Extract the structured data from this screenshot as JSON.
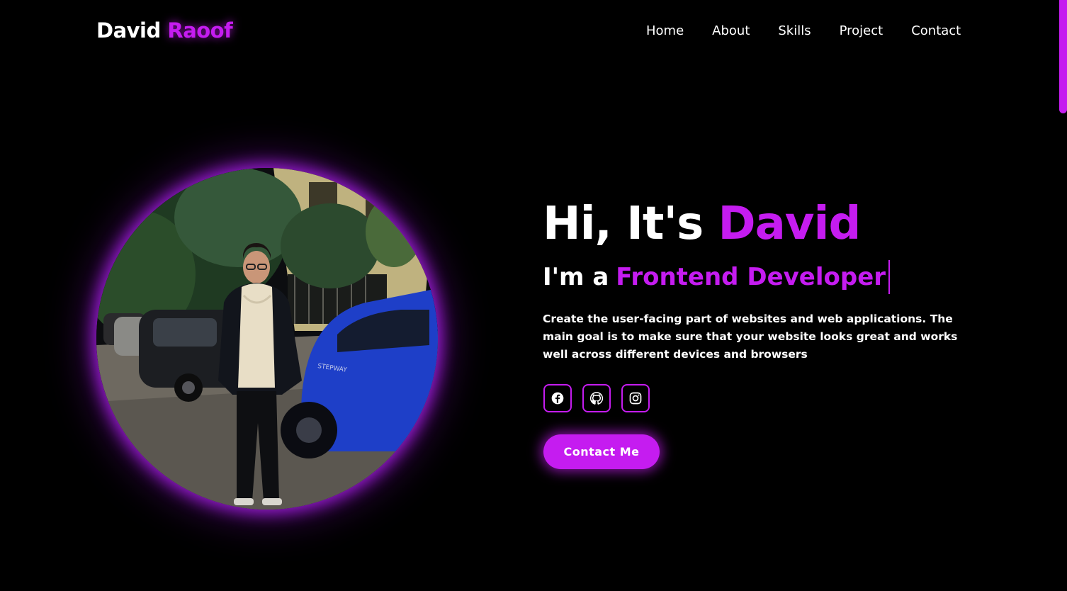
{
  "header": {
    "logo_first": "David",
    "logo_second": "Raoof",
    "nav": [
      {
        "label": "Home"
      },
      {
        "label": "About"
      },
      {
        "label": "Skills"
      },
      {
        "label": "Project"
      },
      {
        "label": "Contact"
      }
    ]
  },
  "hero": {
    "greeting": "Hi, It's",
    "name": "David",
    "role_prefix": "I'm a",
    "role": "Frontend Developer",
    "description": "Create the user-facing part of websites and web applications. The main goal is to make sure that your website looks great and works well across different devices and browsers",
    "socials": [
      {
        "icon": "facebook-icon"
      },
      {
        "icon": "github-icon"
      },
      {
        "icon": "instagram-icon"
      }
    ],
    "cta_label": "Contact Me"
  },
  "colors": {
    "accent": "#c51cf0",
    "background": "#000000",
    "text": "#ffffff"
  }
}
